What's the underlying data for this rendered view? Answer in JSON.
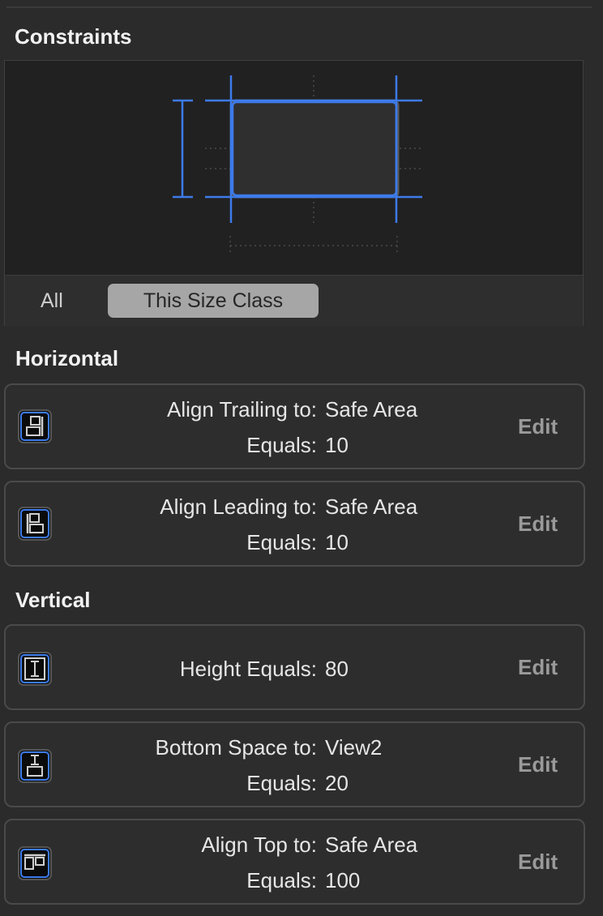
{
  "sections": {
    "constraints": "Constraints",
    "horizontal": "Horizontal",
    "vertical": "Vertical"
  },
  "scope": {
    "all": "All",
    "this_size_class": "This Size Class",
    "selected": "This Size Class"
  },
  "colors": {
    "accent": "#3d7bea",
    "background": "#2b2b2b",
    "preview_bg": "#212121"
  },
  "horizontal": [
    {
      "icon": "align-trailing-icon",
      "line1_label": "Align Trailing to:",
      "line1_value": "Safe Area",
      "line2_label": "Equals:",
      "line2_value": "10",
      "edit": "Edit"
    },
    {
      "icon": "align-leading-icon",
      "line1_label": "Align Leading to:",
      "line1_value": "Safe Area",
      "line2_label": "Equals:",
      "line2_value": "10",
      "edit": "Edit"
    }
  ],
  "vertical": [
    {
      "icon": "height-icon",
      "line1_label": "Height Equals:",
      "line1_value": "80",
      "edit": "Edit"
    },
    {
      "icon": "bottom-space-icon",
      "line1_label": "Bottom Space to:",
      "line1_value": "View2",
      "line2_label": "Equals:",
      "line2_value": "20",
      "edit": "Edit"
    },
    {
      "icon": "align-top-icon",
      "line1_label": "Align Top to:",
      "line1_value": "Safe Area",
      "line2_label": "Equals:",
      "line2_value": "100",
      "edit": "Edit"
    }
  ]
}
